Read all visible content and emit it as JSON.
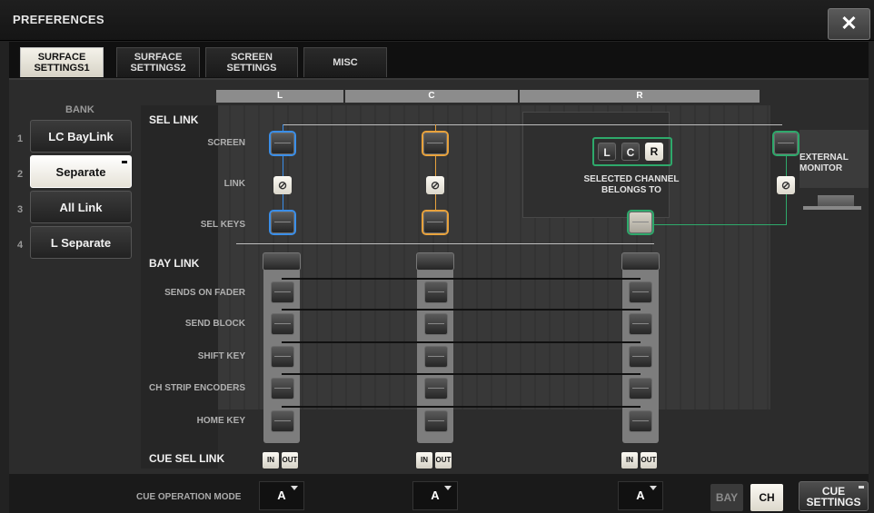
{
  "window": {
    "title": "PREFERENCES",
    "close_icon": "close-icon"
  },
  "tabs": [
    {
      "label": "SURFACE\nSETTINGS1",
      "active": true
    },
    {
      "label": "SURFACE\nSETTINGS2",
      "active": false
    },
    {
      "label": "SCREEN\nSETTINGS",
      "active": false
    },
    {
      "label": "MISC",
      "active": false
    }
  ],
  "bank": {
    "label": "BANK",
    "items": [
      {
        "num": "1",
        "label": "LC BayLink",
        "selected": false
      },
      {
        "num": "2",
        "label": "Separate",
        "selected": true
      },
      {
        "num": "3",
        "label": "All Link",
        "selected": false
      },
      {
        "num": "4",
        "label": "L Separate",
        "selected": false
      }
    ]
  },
  "columns": [
    "L",
    "C",
    "R"
  ],
  "sel_link": {
    "title": "SEL LINK",
    "rows": [
      "SCREEN",
      "LINK",
      "SEL KEYS"
    ],
    "selected_channel": {
      "buttons": [
        "L",
        "C",
        "R"
      ],
      "lit": "R",
      "caption": "SELECTED CHANNEL\nBELONGS TO"
    },
    "external_monitor": "EXTERNAL\nMONITOR"
  },
  "bay_link": {
    "title": "BAY LINK",
    "rows": [
      "SENDS ON FADER",
      "SEND BLOCK",
      "SHIFT KEY",
      "CH STRIP ENCODERS",
      "HOME KEY"
    ]
  },
  "cue_sel_link": {
    "title": "CUE SEL LINK",
    "in_label": "IN",
    "out_label": "OUT"
  },
  "footer": {
    "cue_operation_mode_label": "CUE OPERATION MODE",
    "modes": [
      "A",
      "A",
      "A"
    ],
    "bay_label": "BAY",
    "ch_label": "CH",
    "cue_settings_label": "CUE\nSETTINGS"
  },
  "colors": {
    "accent_blue": "#3a8ee8",
    "accent_orange": "#e8a23c",
    "accent_green": "#2ea96b"
  }
}
